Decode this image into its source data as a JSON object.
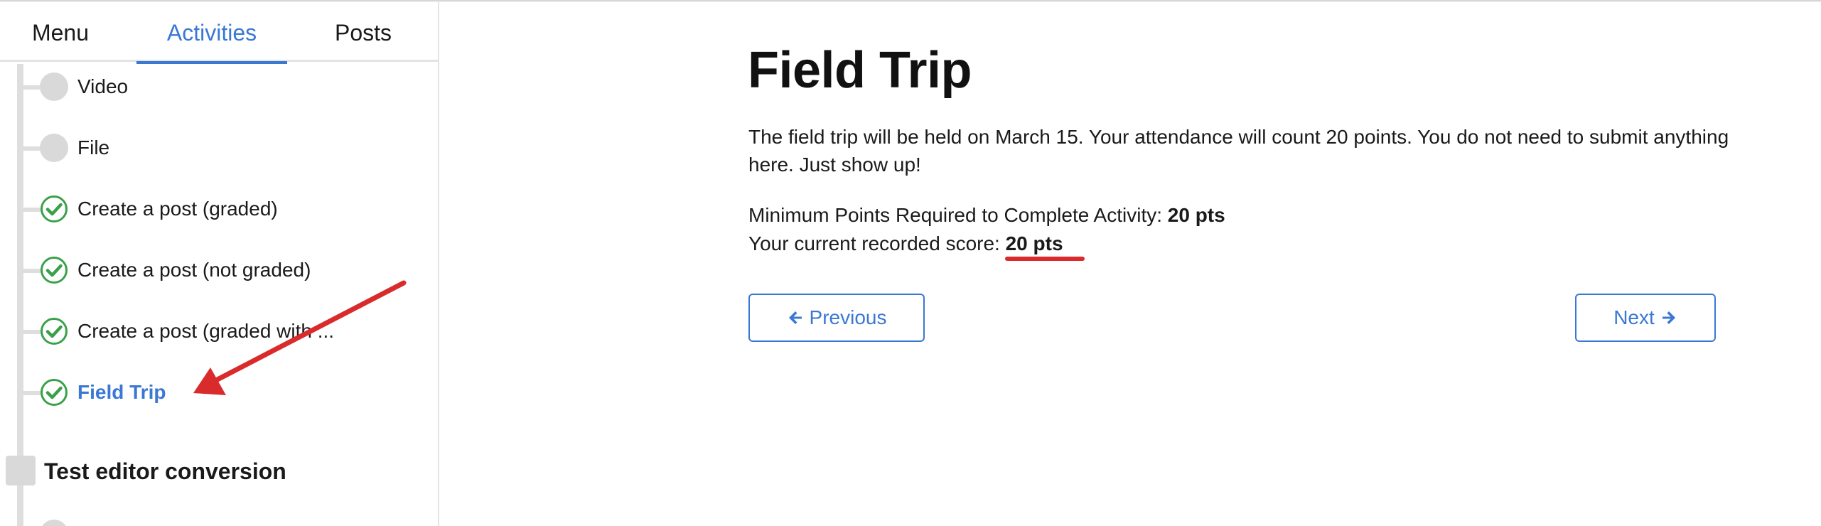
{
  "tabs": [
    {
      "label": "Menu"
    },
    {
      "label": "Activities"
    },
    {
      "label": "Posts"
    }
  ],
  "activities": [
    {
      "label": "Video",
      "status": "incomplete"
    },
    {
      "label": "File",
      "status": "incomplete"
    },
    {
      "label": "Create a post (graded)",
      "status": "complete"
    },
    {
      "label": "Create a post (not graded)",
      "status": "complete"
    },
    {
      "label": "Create a post (graded with ...",
      "status": "complete"
    },
    {
      "label": "Field Trip",
      "status": "complete",
      "active": true
    }
  ],
  "section": {
    "label": "Test editor conversion"
  },
  "content": {
    "title": "Field Trip",
    "description": "The field trip will be held on March 15. Your attendance will count 20 points. You do not need to submit anything here. Just show up!",
    "min_points_label": "Minimum Points Required to Complete Activity:",
    "min_points_value": "20 pts",
    "score_label": "Your current recorded score:",
    "score_value": "20 pts"
  },
  "nav": {
    "previous_label": "Previous",
    "next_label": "Next"
  },
  "colors": {
    "accent": "#3a78d4",
    "check": "#3aa04a",
    "annotation": "#d92b2b"
  },
  "icons": [
    "check-circle-icon",
    "arrow-left-icon",
    "arrow-right-icon"
  ]
}
